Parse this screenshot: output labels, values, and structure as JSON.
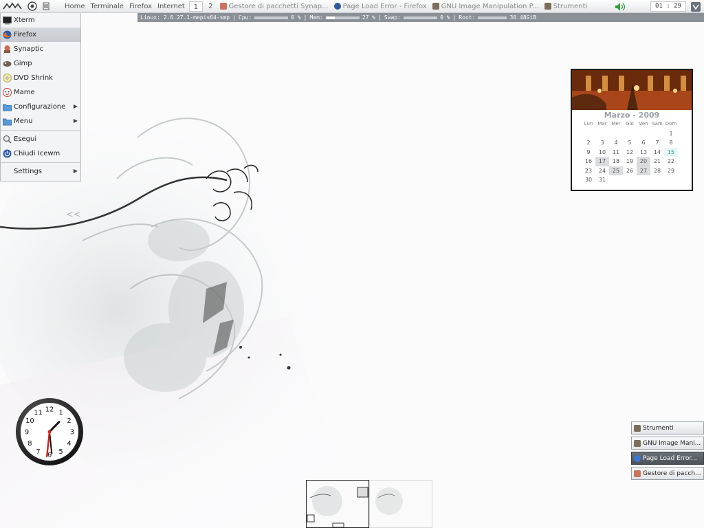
{
  "taskbar": {
    "links": [
      "Home",
      "Terminale",
      "Firefox",
      "Internet"
    ],
    "workspaces": [
      "1",
      "2"
    ],
    "active_workspace": "1",
    "tasks": [
      {
        "label": "Gestore di pacchetti Synap...",
        "icon": "synaptic-icon"
      },
      {
        "label": "Page Load Error - Firefox",
        "icon": "firefox-icon"
      },
      {
        "label": "GNU Image Manipulation P...",
        "icon": "gimp-icon"
      },
      {
        "label": "Strumenti",
        "icon": "gimp-icon"
      }
    ],
    "clock": "01 : 29"
  },
  "statusbar": {
    "kernel": "Linux: 2.6.27.1-mepis64-smp",
    "cpu_label": "Cpu:",
    "cpu_value": "0 %",
    "cpu_pct": 0,
    "mem_label": "Mem:",
    "mem_value": "27 %",
    "mem_pct": 27,
    "swap_label": "Swap:",
    "swap_value": "0 %",
    "swap_pct": 0,
    "root_label": "Root:",
    "root_value": "30.48GiB"
  },
  "start_menu": {
    "items": [
      {
        "label": "Xterm",
        "icon": "terminal-icon"
      },
      {
        "label": "Firefox",
        "icon": "firefox-icon",
        "selected": true
      },
      {
        "label": "Synaptic",
        "icon": "synaptic-icon"
      },
      {
        "label": "Gimp",
        "icon": "gimp-icon"
      },
      {
        "label": "DVD Shrink",
        "icon": "dvd-icon"
      },
      {
        "label": "Mame",
        "icon": "mame-icon"
      },
      {
        "label": "Configurazione",
        "icon": "folder-icon",
        "submenu": true
      },
      {
        "label": "Menu",
        "icon": "folder-icon",
        "submenu": true
      },
      {
        "label": "Esegui",
        "icon": "run-icon"
      },
      {
        "label": "Chiudi Icewm",
        "icon": "logout-icon"
      },
      {
        "label": "Settings",
        "icon": "",
        "submenu": true
      }
    ]
  },
  "calendar": {
    "title": "Marzo - 2009",
    "weekdays": [
      "Lun",
      "Mar",
      "Mer",
      "Gio",
      "Ven",
      "Sam",
      "Dom"
    ],
    "first_weekday_index": 6,
    "days_in_month": 31,
    "today": 15,
    "highlighted": [
      17,
      20,
      25,
      27
    ]
  },
  "analog_clock": {
    "numerals": [
      "12",
      "1",
      "2",
      "3",
      "4",
      "5",
      "6",
      "7",
      "8",
      "9",
      "10",
      "11"
    ],
    "hours": 1,
    "minutes": 29,
    "seconds": 31
  },
  "window_list": [
    {
      "label": "Strumenti",
      "icon": "gimp-icon",
      "active": false
    },
    {
      "label": "GNU Image Mani...",
      "icon": "gimp-icon",
      "active": false
    },
    {
      "label": "Page Load Error...",
      "icon": "firefox-icon",
      "active": true
    },
    {
      "label": "Gestore di pacch...",
      "icon": "synaptic-icon",
      "active": false
    }
  ],
  "pager": {
    "desktops": [
      "1",
      "2"
    ],
    "active": "1"
  },
  "colors": {
    "accent": "#8a9096",
    "today": "#2aa7a7",
    "clock_hand_seconds": "#d9221c"
  }
}
